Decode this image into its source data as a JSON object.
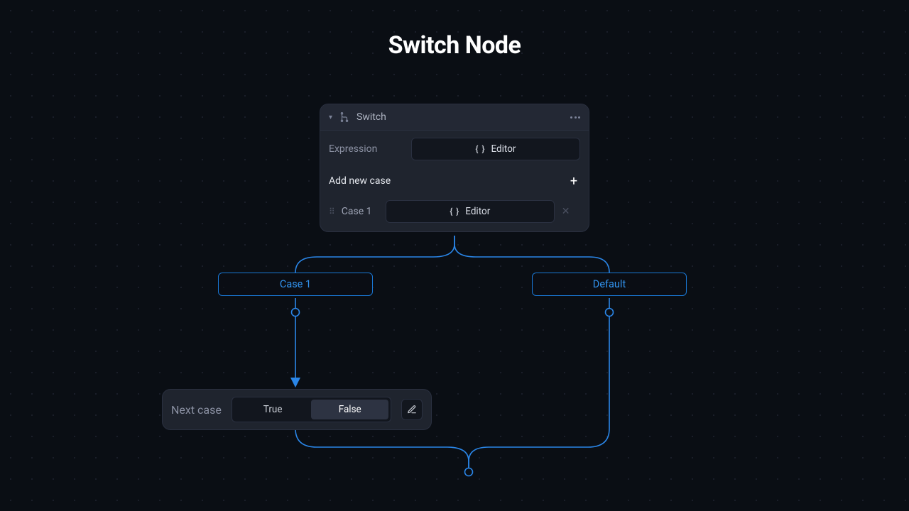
{
  "page": {
    "title": "Switch Node"
  },
  "node": {
    "title": "Switch",
    "expression_label": "Expression",
    "editor_btn_label": "Editor",
    "add_case_label": "Add new case",
    "cases": [
      {
        "name": "Case 1",
        "editor_label": "Editor"
      }
    ]
  },
  "outlets": {
    "case1": "Case 1",
    "default": "Default"
  },
  "next_case": {
    "label": "Next case",
    "true_label": "True",
    "false_label": "False",
    "selected": "False"
  },
  "colors": {
    "connector": "#2a86e8",
    "accent_border": "#1977d4"
  }
}
